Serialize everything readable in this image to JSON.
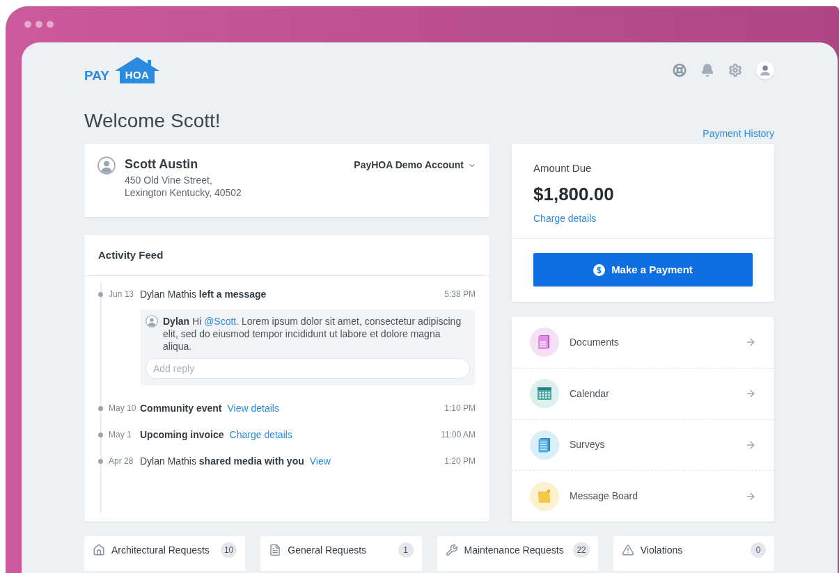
{
  "logo": {
    "prefix": "PAY",
    "mark": "HOA"
  },
  "welcome": "Welcome Scott!",
  "payment_history": "Payment History",
  "profile": {
    "name": "Scott Austin",
    "address_line_1": "450 Old Vine Street,",
    "address_line_2": "Lexington Kentucky, 40502",
    "account": "PayHOA Demo Account"
  },
  "activity_feed": {
    "title": "Activity Feed",
    "items": [
      {
        "kind": "message",
        "date": "Jun 13",
        "title": "Dylan Mathis **left a message**",
        "emphasis": false,
        "time": "5:38 PM",
        "message": {
          "author": "Dylan",
          "greeting": "Hi",
          "mention": "@Scott.",
          "body": "Lorem ipsum dolor sit amet, consectetur adipiscing elit, sed do eiusmod tempor incididunt ut labore et dolore magna aliqua."
        },
        "reply_placeholder": "Add reply"
      },
      {
        "kind": "event",
        "date": "May 10",
        "title": "Community event",
        "emphasis": true,
        "link": "View details",
        "time": "1:10 PM"
      },
      {
        "kind": "event",
        "date": "May 1",
        "title": "Upcoming invoice",
        "emphasis": true,
        "link": "Charge details",
        "time": "11:00 AM"
      },
      {
        "kind": "event",
        "date": "Apr 28",
        "title": "Dylan Mathis **shared media with you**",
        "emphasis": false,
        "link": "View",
        "time": "1:20 PM"
      }
    ]
  },
  "amount_due": {
    "label": "Amount Due",
    "amount": "$1,800.00",
    "link": "Charge details",
    "button": "Make a Payment"
  },
  "shortcuts": [
    {
      "kind": "documents",
      "label": "Documents"
    },
    {
      "kind": "calendar",
      "label": "Calendar"
    },
    {
      "kind": "surveys",
      "label": "Surveys"
    },
    {
      "kind": "message_board",
      "label": "Message Board"
    }
  ],
  "request_cards": [
    {
      "kind": "architectural",
      "label": "Architectural Requests",
      "count": "10"
    },
    {
      "kind": "general",
      "label": "General Requests",
      "count": "1"
    },
    {
      "kind": "maintenance",
      "label": "Maintenance Requests",
      "count": "22"
    },
    {
      "kind": "violations",
      "label": "Violations",
      "count": "0"
    }
  ]
}
